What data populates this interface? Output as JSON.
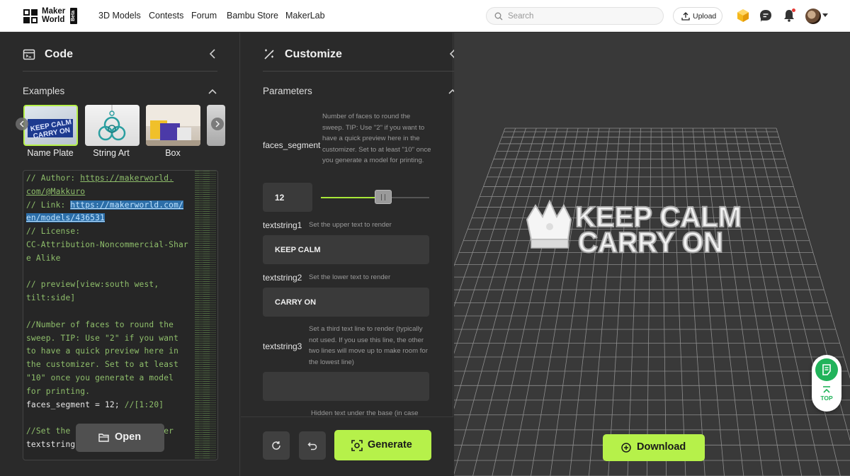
{
  "header": {
    "logo_text": "Maker\nWorld",
    "logo_badge": "Beta",
    "nav": [
      "3D Models",
      "Contests",
      "Forum",
      "Bambu Store",
      "MakerLab"
    ],
    "search_placeholder": "Search",
    "upload_label": "Upload"
  },
  "code_panel": {
    "title": "Code",
    "examples_title": "Examples",
    "examples": [
      {
        "label": "Name Plate"
      },
      {
        "label": "String Art"
      },
      {
        "label": "Box"
      }
    ],
    "open_label": "Open"
  },
  "customize_panel": {
    "title": "Customize",
    "parameters_title": "Parameters",
    "faces_segment": {
      "name": "faces_segment",
      "description": "Number of faces to round the sweep. TIP: Use \"2\" if you want to have a quick preview here in the customizer. Set to at least \"10\" once you generate a model for printing.",
      "value": "12",
      "slider_fraction": 0.55
    },
    "textstring1": {
      "name": "textstring1",
      "description": "Set the upper text to render",
      "value": "KEEP CALM"
    },
    "textstring2": {
      "name": "textstring2",
      "description": "Set the lower text to render",
      "value": "CARRY ON"
    },
    "textstring3": {
      "name": "textstring3",
      "description": "Set a third text line to render (typically not used. If you use this line, the other two lines will move up to make room for the lowest line)",
      "value": ""
    },
    "hidden_next": {
      "description": "Hidden text under the base (in case"
    },
    "generate_label": "Generate"
  },
  "viewport": {
    "model_line1": "KEEP CALM",
    "model_line2": "CARRY ON",
    "download_label": "Download",
    "top_label": "TOP"
  },
  "colors": {
    "accent": "#b6f14a",
    "panel_bg": "#2a2a2a",
    "viewport_bg": "#393939",
    "code_comment": "#8fbf6b",
    "selection": "#2c6ea8",
    "note_green": "#21b35a"
  },
  "icons": [
    "code-icon",
    "customize-icon",
    "chevron-left-icon",
    "chevron-up-icon",
    "search-icon",
    "upload-icon",
    "bambu-cube-icon",
    "chat-icon",
    "bell-icon",
    "folder-icon",
    "reset-icon",
    "undo-icon",
    "generate-icon",
    "download-icon",
    "note-icon",
    "arrow-top-icon"
  ]
}
